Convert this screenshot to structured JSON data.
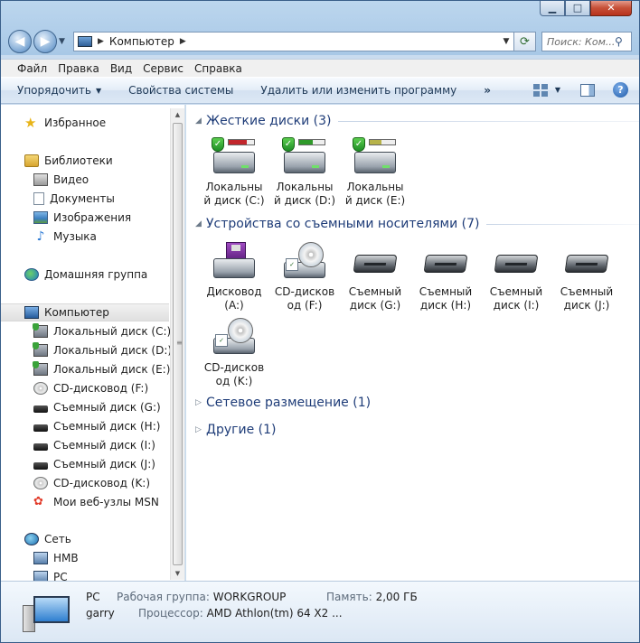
{
  "window": {
    "caption_buttons": {
      "minimize": "▁",
      "maximize": "□",
      "close": "✕"
    }
  },
  "address": {
    "path": "Компьютер",
    "search_placeholder": "Поиск: Ком..."
  },
  "menu": [
    "Файл",
    "Правка",
    "Вид",
    "Сервис",
    "Справка"
  ],
  "toolbar": {
    "organize": "Упорядочить",
    "system_properties": "Свойства системы",
    "uninstall": "Удалить или изменить программу",
    "more": "»"
  },
  "navpane": {
    "items": [
      {
        "label": "Избранное",
        "icon": "star-icon"
      },
      {
        "label": "Библиотеки",
        "icon": "folder-icon"
      },
      {
        "label": "Видео",
        "icon": "video-icon"
      },
      {
        "label": "Документы",
        "icon": "document-icon"
      },
      {
        "label": "Изображения",
        "icon": "image-icon"
      },
      {
        "label": "Музыка",
        "icon": "music-icon"
      },
      {
        "label": "Домашняя группа",
        "icon": "homegroup-icon"
      },
      {
        "label": "Компьютер",
        "icon": "computer-icon",
        "selected": true
      },
      {
        "label": "Локальный диск (C:)",
        "icon": "hdd-icon"
      },
      {
        "label": "Локальный диск (D:)",
        "icon": "hdd-icon"
      },
      {
        "label": "Локальный диск (E:)",
        "icon": "hdd-icon"
      },
      {
        "label": "CD-дисковод (F:)",
        "icon": "cd-icon"
      },
      {
        "label": "Съемный диск (G:)",
        "icon": "removable-disk-icon"
      },
      {
        "label": "Съемный диск (H:)",
        "icon": "removable-disk-icon"
      },
      {
        "label": "Съемный диск (I:)",
        "icon": "removable-disk-icon"
      },
      {
        "label": "Съемный диск (J:)",
        "icon": "removable-disk-icon"
      },
      {
        "label": "CD-дисковод (K:)",
        "icon": "cd-icon"
      },
      {
        "label": "Мои веб-узлы MSN",
        "icon": "msn-icon"
      },
      {
        "label": "Сеть",
        "icon": "network-icon"
      },
      {
        "label": "HMB",
        "icon": "pc-icon"
      },
      {
        "label": "PC",
        "icon": "pc-icon"
      }
    ]
  },
  "content": {
    "groups": [
      {
        "title": "Жесткие диски (3)",
        "expanded": true
      },
      {
        "title": "Устройства со съемными носителями (7)",
        "expanded": true
      },
      {
        "title": "Сетевое размещение (1)",
        "expanded": false
      },
      {
        "title": "Другие (1)",
        "expanded": false
      }
    ],
    "hard_disks": [
      {
        "line1": "Локальны",
        "line2": "й диск (C:)",
        "used_fraction": 0.7,
        "bar_color": "#c2262c"
      },
      {
        "line1": "Локальны",
        "line2": "й диск (D:)",
        "used_fraction": 0.55,
        "bar_color": "#2f9a2a"
      },
      {
        "line1": "Локальны",
        "line2": "й диск (E:)",
        "used_fraction": 0.45,
        "bar_color": "#b7b34a"
      }
    ],
    "removable": [
      {
        "line1": "Дисковод",
        "line2": "(A:)",
        "kind": "floppy"
      },
      {
        "line1": "CD-дисков",
        "line2": "од (F:)",
        "kind": "cd"
      },
      {
        "line1": "Съемный",
        "line2": "диск (G:)",
        "kind": "removable"
      },
      {
        "line1": "Съемный",
        "line2": "диск (H:)",
        "kind": "removable"
      },
      {
        "line1": "Съемный",
        "line2": "диск (I:)",
        "kind": "removable"
      },
      {
        "line1": "Съемный",
        "line2": "диск (J:)",
        "kind": "removable"
      },
      {
        "line1": "CD-дисков",
        "line2": "од (K:)",
        "kind": "cd"
      }
    ]
  },
  "details": {
    "name": "PC",
    "user": "garry",
    "workgroup_label": "Рабочая группа:",
    "workgroup_value": "WORKGROUP",
    "memory_label": "Память:",
    "memory_value": "2,00 ГБ",
    "cpu_label": "Процессор:",
    "cpu_value": "AMD Athlon(tm) 64 X2 ..."
  }
}
